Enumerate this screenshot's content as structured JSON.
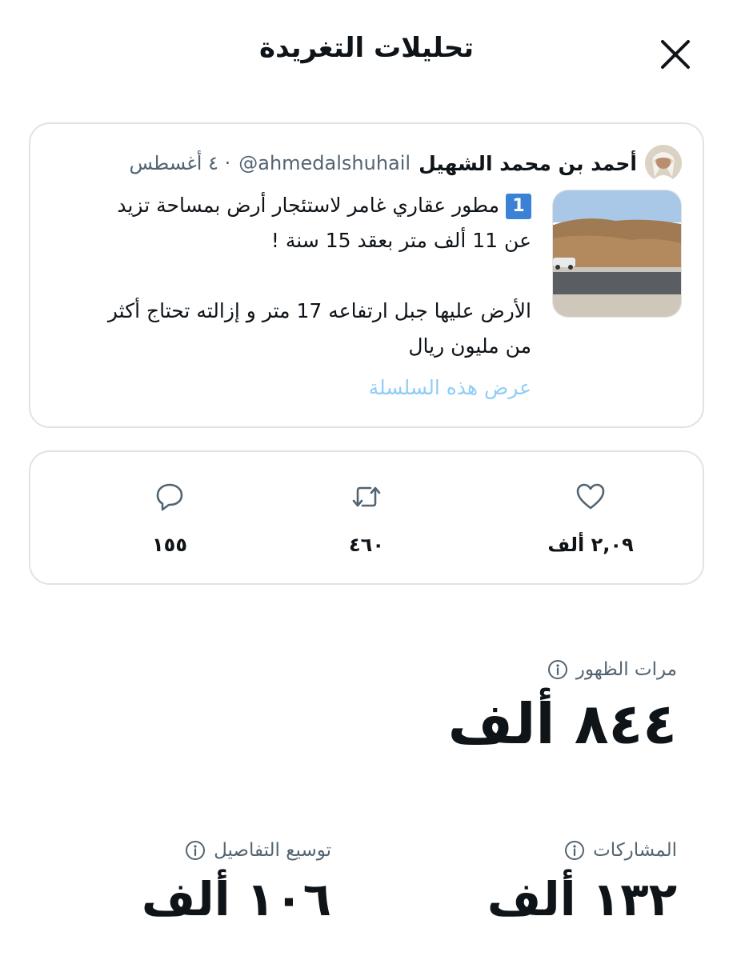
{
  "header": {
    "title": "تحليلات التغريدة"
  },
  "tweet": {
    "author_name": "أحمد بن محمد الشهيل",
    "handle": "@ahmedalshuhail",
    "date": "· ٤ أغسطس",
    "badge_number": "1",
    "line1": "مطور عقاري غامر لاستئجار أرض بمساحة تزيد",
    "line2": "عن 11 ألف متر بعقد 15 سنة !",
    "line3": "الأرض عليها جبل ارتفاعه 17 متر و إزالته تحتاج أكثر",
    "line4": "من مليون ريال",
    "show_thread": "عرض هذه السلسلة"
  },
  "stats": {
    "likes": "٢,٠٩ ألف",
    "retweets": "٤٦٠",
    "replies": "١٥٥"
  },
  "metrics": {
    "impressions_label": "مرات الظهور",
    "impressions_value": "٨٤٤ ألف",
    "engagements_label": "المشاركات",
    "engagements_value": "١٣٢ ألف",
    "detail_expands_label": "توسيع التفاصيل",
    "detail_expands_value": "١٠٦ ألف"
  },
  "colors": {
    "text": "#0f1419",
    "secondary": "#536471",
    "link": "#8ecdf8",
    "badge": "#3b82d6",
    "border": "#dfe3e7"
  }
}
